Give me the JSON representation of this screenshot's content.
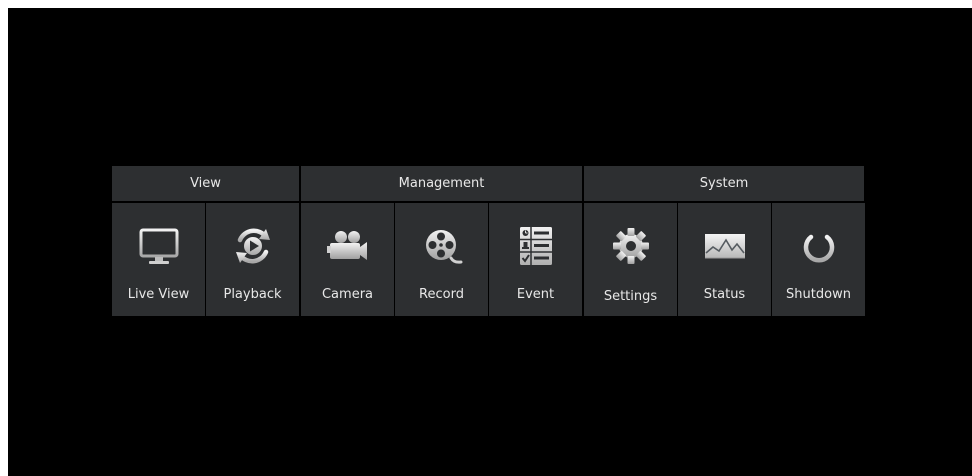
{
  "groups": {
    "view": {
      "label": "View"
    },
    "management": {
      "label": "Management"
    },
    "system": {
      "label": "System"
    }
  },
  "tiles": {
    "live_view": {
      "label": "Live View",
      "icon": "monitor-grid-icon"
    },
    "playback": {
      "label": "Playback",
      "icon": "playback-icon"
    },
    "camera": {
      "label": "Camera",
      "icon": "camera-icon"
    },
    "record": {
      "label": "Record",
      "icon": "film-reel-icon"
    },
    "event": {
      "label": "Event",
      "icon": "event-list-icon"
    },
    "settings": {
      "label": "Settings",
      "icon": "gear-icon"
    },
    "status": {
      "label": "Status",
      "icon": "status-chart-icon"
    },
    "shutdown": {
      "label": "Shutdown",
      "icon": "power-icon"
    }
  },
  "colors": {
    "background": "#000000",
    "tile": "#2d2f31",
    "text": "#e8e8e8",
    "icon": "#d9d9d9"
  }
}
